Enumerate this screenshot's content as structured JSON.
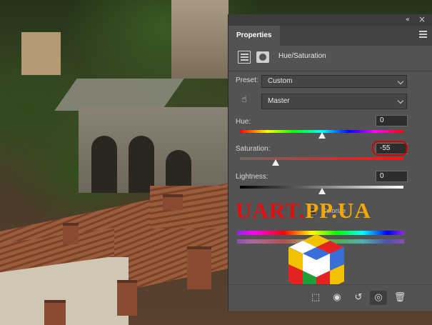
{
  "panel": {
    "tab_label": "Properties",
    "adjustment_title": "Hue/Saturation",
    "collapse_glyph": "«",
    "close_glyph": "×"
  },
  "preset": {
    "label": "Preset:",
    "value": "Custom"
  },
  "channel": {
    "value": "Master"
  },
  "hue": {
    "label": "Hue:",
    "value": "0",
    "level_percent": 50
  },
  "saturation": {
    "label": "Saturation:",
    "value": "-55",
    "level_percent": 22
  },
  "lightness": {
    "label": "Lightness:",
    "value": "0",
    "level_percent": 50
  },
  "colorize": {
    "label": "Colorize"
  },
  "watermark": {
    "part_a": "UART.",
    "part_b": "PP.UA"
  },
  "bottom_toolbar": {
    "icons": [
      "clip-to-layer-icon",
      "view-previous-state-icon",
      "reset-icon",
      "visibility-eye-icon",
      "trash-icon"
    ]
  },
  "colors": {
    "panel_bg": "#535353",
    "highlight_ring": "#d10000",
    "watermark_red": "#e11010",
    "watermark_orange": "#f5a800"
  }
}
